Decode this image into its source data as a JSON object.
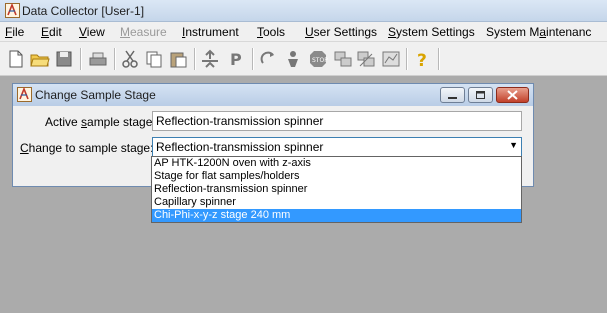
{
  "window": {
    "title": "Data Collector [User-1]"
  },
  "menu": [
    {
      "label": "File",
      "enabled": true
    },
    {
      "label": "Edit",
      "enabled": true
    },
    {
      "label": "View",
      "enabled": true
    },
    {
      "label": "Measure",
      "enabled": false
    },
    {
      "label": "Instrument",
      "enabled": true
    },
    {
      "label": "Tools",
      "enabled": true
    },
    {
      "label": "User Settings",
      "enabled": true
    },
    {
      "label": "System Settings",
      "enabled": true
    },
    {
      "label": "System Maintenanc",
      "enabled": true
    }
  ],
  "toolbar": {
    "icons": [
      "new-document-icon",
      "open-folder-icon",
      "save-icon",
      "print-icon",
      "cut-icon",
      "copy-icon",
      "paste-icon",
      "execute-icon",
      "program-icon",
      "reset-icon",
      "position-icon",
      "stop-icon",
      "connect-icon",
      "disconnect-icon",
      "chart-icon",
      "help-icon"
    ]
  },
  "dialog": {
    "title": "Change Sample Stage",
    "active_label": "Active sample stage:",
    "active_value": "Reflection-transmission spinner",
    "change_label": "Change to sample stage:",
    "change_value": "Reflection-transmission spinner",
    "options": [
      "AP HTK-1200N oven with z-axis",
      "Stage for flat samples/holders",
      "Reflection-transmission spinner",
      "Capillary spinner",
      "Chi-Phi-x-y-z stage 240 mm"
    ],
    "highlighted_option": "Chi-Phi-x-y-z stage 240 mm"
  },
  "colors": {
    "highlight": "#3399ff",
    "titlebar": "#c5d6ea",
    "workspace": "#ababab"
  }
}
